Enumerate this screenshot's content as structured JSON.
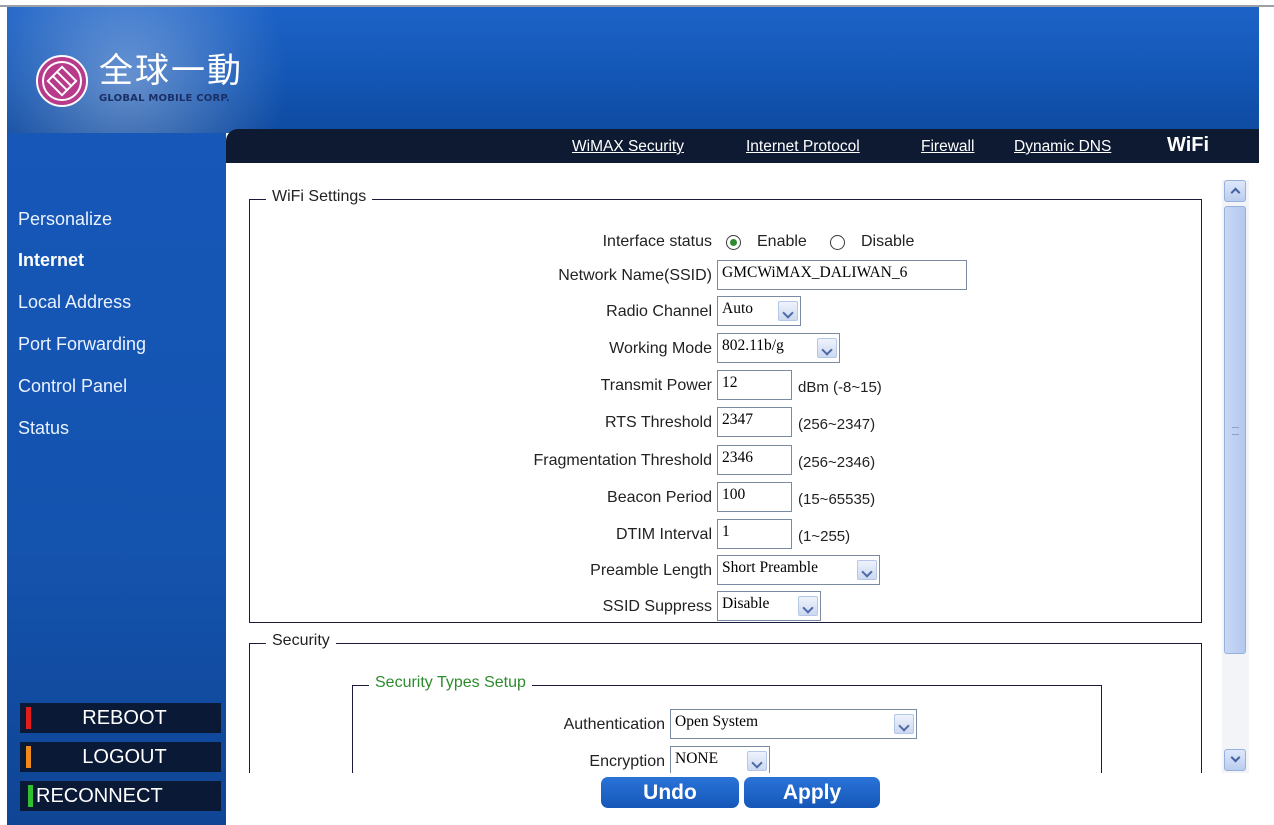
{
  "brand": {
    "name_cn": "全球一動",
    "name_en": "GLOBAL MOBILE CORP."
  },
  "nav": {
    "items": [
      "WiMAX Security",
      "Internet Protocol",
      "Firewall",
      "Dynamic DNS"
    ],
    "active": "WiFi"
  },
  "sidebar": {
    "items": [
      "Personalize",
      "Internet",
      "Local Address",
      "Port Forwarding",
      "Control Panel",
      "Status"
    ],
    "active_index": 1,
    "buttons": [
      {
        "label": "REBOOT",
        "color": "#e21b1b"
      },
      {
        "label": "LOGOUT",
        "color": "#f08a1c"
      },
      {
        "label": "RECONNECT",
        "color": "#2fbf2f"
      }
    ]
  },
  "wifi": {
    "legend": "WiFi Settings",
    "interface_status": {
      "label": "Interface status",
      "enable": "Enable",
      "disable": "Disable",
      "selected": "Enable"
    },
    "ssid": {
      "label": "Network Name(SSID)",
      "value": "GMCWiMAX_DALIWAN_6"
    },
    "radio_channel": {
      "label": "Radio Channel",
      "value": "Auto"
    },
    "working_mode": {
      "label": "Working Mode",
      "value": "802.11b/g"
    },
    "transmit_power": {
      "label": "Transmit Power",
      "value": "12",
      "note": "dBm (-8~15)"
    },
    "rts_threshold": {
      "label": "RTS Threshold",
      "value": "2347",
      "note": "(256~2347)"
    },
    "frag_threshold": {
      "label": "Fragmentation Threshold",
      "value": "2346",
      "note": "(256~2346)"
    },
    "beacon_period": {
      "label": "Beacon Period",
      "value": "100",
      "note": "(15~65535)"
    },
    "dtim_interval": {
      "label": "DTIM Interval",
      "value": "1",
      "note": "(1~255)"
    },
    "preamble_length": {
      "label": "Preamble Length",
      "value": "Short Preamble"
    },
    "ssid_suppress": {
      "label": "SSID Suppress",
      "value": "Disable"
    }
  },
  "security": {
    "legend": "Security",
    "types_legend": "Security Types Setup",
    "authentication": {
      "label": "Authentication",
      "value": "Open System"
    },
    "encryption": {
      "label": "Encryption",
      "value": "NONE"
    }
  },
  "actions": {
    "undo": "Undo",
    "apply": "Apply"
  },
  "colors": {
    "header_blue": "#1356b5",
    "nav_dark": "#0d1a31",
    "radio_green": "#2e8b2e",
    "button_blue": "#1b63c8"
  }
}
